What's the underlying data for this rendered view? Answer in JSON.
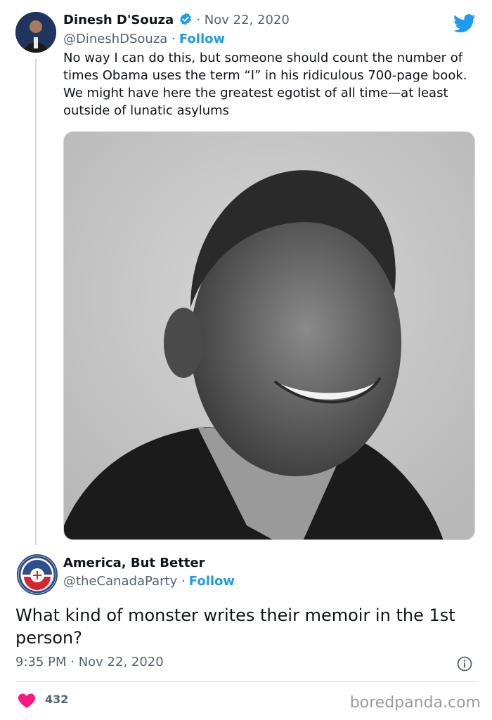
{
  "tweet": {
    "author_name": "Dinesh D'Souza",
    "date": "· Nov 22, 2020",
    "handle": "@DineshDSouza ·",
    "follow_label": "Follow",
    "text": "No way I can do this, but someone should count the number of times Obama uses the term “I” in his ridiculous 700-page book. We might have here the greatest egotist of all time—at least outside of lunatic asylums",
    "icons": {
      "verified": "verified-badge-icon",
      "twitter": "twitter-bird-icon"
    }
  },
  "reply": {
    "author_name": "America, But Better",
    "handle": "@theCanadaParty ·",
    "follow_label": "Follow",
    "text": "What kind of monster writes their memoir in the 1st person?",
    "timestamp": "9:35 PM · Nov 22, 2020",
    "likes": "432",
    "icons": {
      "info": "info-icon",
      "heart": "heart-icon"
    }
  },
  "watermark": "boredpanda.com",
  "colors": {
    "accent": "#1d9bf0",
    "heart": "#f91880",
    "secondary_text": "#536471",
    "border": "#cfd9de"
  }
}
